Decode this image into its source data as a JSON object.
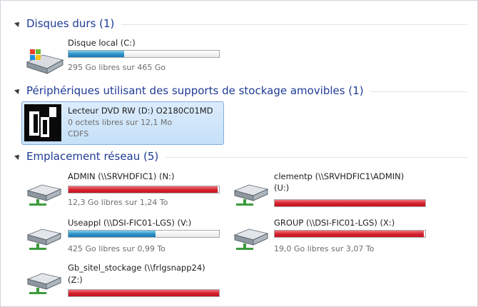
{
  "groups": [
    {
      "title": "Disques durs (1)"
    },
    {
      "title": "Périphériques utilisant des supports de stockage amovibles (1)"
    },
    {
      "title": "Emplacement réseau (5)"
    }
  ],
  "hard_disks": [
    {
      "name": "Disque local (C:)",
      "free_text": "295 Go libres sur 465 Go",
      "used_fraction": 0.37,
      "status": "normal",
      "icon": "local-disk-icon"
    }
  ],
  "removable": [
    {
      "name": "Lecteur DVD RW (D:) O2180C01MD",
      "free_text": "0 octets libres sur 12,1 Mo",
      "filesystem": "CDFS",
      "icon": "dvd-drive-icon"
    }
  ],
  "network": [
    {
      "name": "ADMIN (\\\\SRVHDFIC1) (N:)",
      "free_text": "12,3 Go libres sur 1,24 To",
      "used_fraction": 0.99,
      "status": "full",
      "icon": "network-drive-icon"
    },
    {
      "name": "clementp (\\\\SRVHDFIC1\\ADMIN)",
      "name_line2": "(U:)",
      "used_fraction": 1.0,
      "status": "full",
      "icon": "network-drive-icon"
    },
    {
      "name": "Useappl (\\\\DSI-FIC01-LGS) (V:)",
      "free_text": "425 Go libres sur 0,99 To",
      "used_fraction": 0.58,
      "status": "normal",
      "icon": "network-drive-icon"
    },
    {
      "name": "GROUP (\\\\DSI-FIC01-LGS) (X:)",
      "free_text": "19,0 Go libres sur 3,07 To",
      "used_fraction": 0.99,
      "status": "full",
      "icon": "network-drive-icon"
    },
    {
      "name": "Gb_sitel_stockage (\\\\frlgsnapp24)",
      "name_line2": "(Z:)",
      "used_fraction": 1.0,
      "status": "full",
      "icon": "network-drive-icon"
    }
  ],
  "colors": {
    "group_title": "#1e3b95",
    "bar_normal": "#2a8fc5",
    "bar_full": "#d2202d",
    "selection": "#cce4f7"
  }
}
